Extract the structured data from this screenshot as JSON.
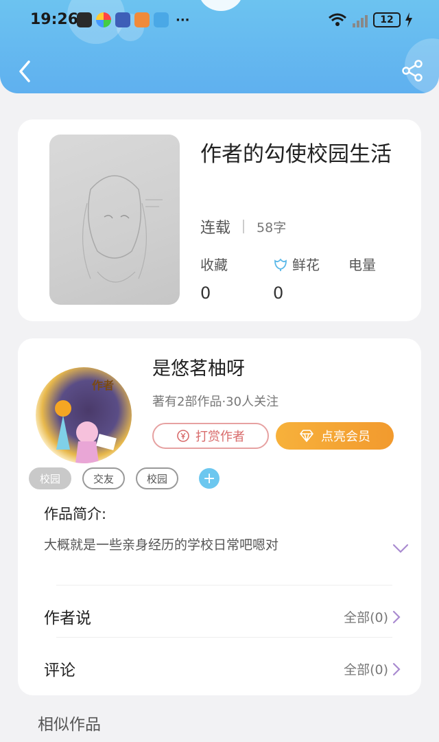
{
  "status_bar": {
    "time": "19:26",
    "battery": "12"
  },
  "book": {
    "title": "作者的勾使校园生活",
    "status": "连载",
    "word_count": "58字",
    "metrics": [
      {
        "label": "收藏",
        "value": "0"
      },
      {
        "label": "鲜花",
        "value": "0"
      },
      {
        "label": "电量",
        "value": ""
      }
    ]
  },
  "author": {
    "name": "是悠茗柚呀",
    "meta": "著有2部作品·30人关注",
    "tip_button": "打赏作者",
    "vip_button": "点亮会员",
    "avatar_badge": "作者"
  },
  "tags": [
    "校园",
    "交友",
    "校园"
  ],
  "intro": {
    "heading": "作品简介:",
    "text": "大概就是一些亲身经历的学校日常吧嗯对"
  },
  "rows": [
    {
      "label": "作者说",
      "right": "全部(0)"
    },
    {
      "label": "评论",
      "right": "全部(0)"
    }
  ],
  "similar_heading": "相似作品",
  "colors": {
    "header": "#5fb0ef",
    "vip": "#f29a2e",
    "tip": "#d86b6b",
    "tag_add": "#6cc7ef"
  }
}
